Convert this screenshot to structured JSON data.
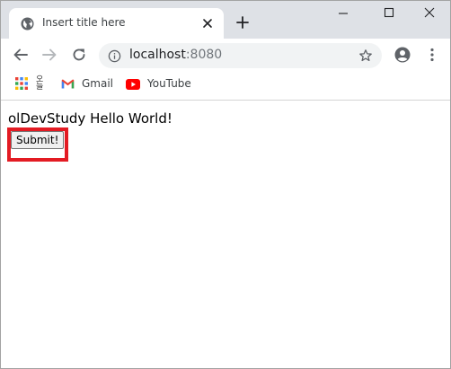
{
  "tab": {
    "title": "Insert title here"
  },
  "address_bar": {
    "host": "localhost",
    "port": ":8080"
  },
  "bookmarks": {
    "korean_item": "오늘",
    "items": [
      {
        "label": "Gmail",
        "icon": "gmail-icon"
      },
      {
        "label": "YouTube",
        "icon": "youtube-icon"
      }
    ]
  },
  "content": {
    "message": "olDevStudy Hello World!",
    "submit_label": "Submit!"
  },
  "colors": {
    "tabstrip": "#dee1e6",
    "highlight": "#e31b23",
    "youtube": "#ff0000"
  }
}
